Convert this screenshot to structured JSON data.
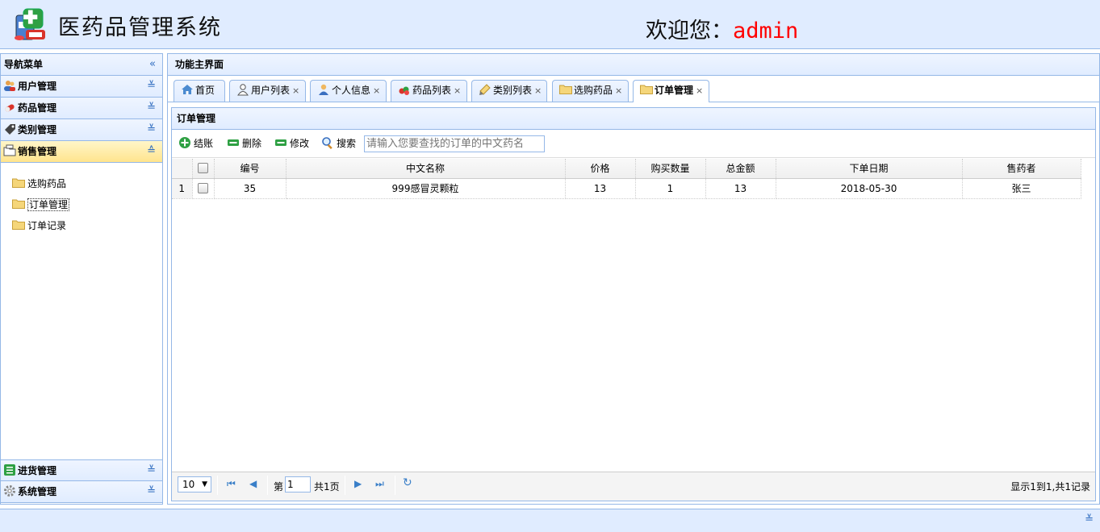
{
  "header": {
    "title": "医药品管理系统",
    "welcome_prefix": "欢迎您：",
    "username": "admin"
  },
  "sidebar": {
    "title": "导航菜单",
    "groups": [
      {
        "label": "用户管理",
        "icon": "users-icon"
      },
      {
        "label": "药品管理",
        "icon": "pill-icon"
      },
      {
        "label": "类别管理",
        "icon": "tag-icon"
      },
      {
        "label": "销售管理",
        "icon": "folder-icon"
      },
      {
        "label": "进货管理",
        "icon": "list-icon"
      },
      {
        "label": "系统管理",
        "icon": "gear-icon"
      }
    ],
    "sales_items": [
      "选购药品",
      "订单管理",
      "订单记录"
    ]
  },
  "main": {
    "title": "功能主界面",
    "tabs": [
      "首页",
      "用户列表",
      "个人信息",
      "药品列表",
      "类别列表",
      "选购药品",
      "订单管理"
    ],
    "panel_title": "订单管理",
    "toolbar": {
      "checkout": "结账",
      "delete": "删除",
      "edit": "修改",
      "search": "搜索",
      "search_placeholder": "请输入您要查找的订单的中文药名"
    },
    "table": {
      "columns": [
        "编号",
        "中文名称",
        "价格",
        "购买数量",
        "总金额",
        "下单日期",
        "售药者"
      ],
      "rows": [
        {
          "rownum": "1",
          "id": "35",
          "name": "999感冒灵颗粒",
          "price": "13",
          "qty": "1",
          "total": "13",
          "date": "2018-05-30",
          "seller": "张三"
        }
      ]
    },
    "pager": {
      "page_size": "10",
      "page_prefix": "第",
      "page_value": "1",
      "page_suffix": "共1页",
      "info": "显示1到1,共1记录"
    }
  },
  "colors": {
    "border": "#95b8e7",
    "header_bg": "#e0ecff",
    "active_bg": "#ffe48d",
    "username": "#ff0000"
  }
}
